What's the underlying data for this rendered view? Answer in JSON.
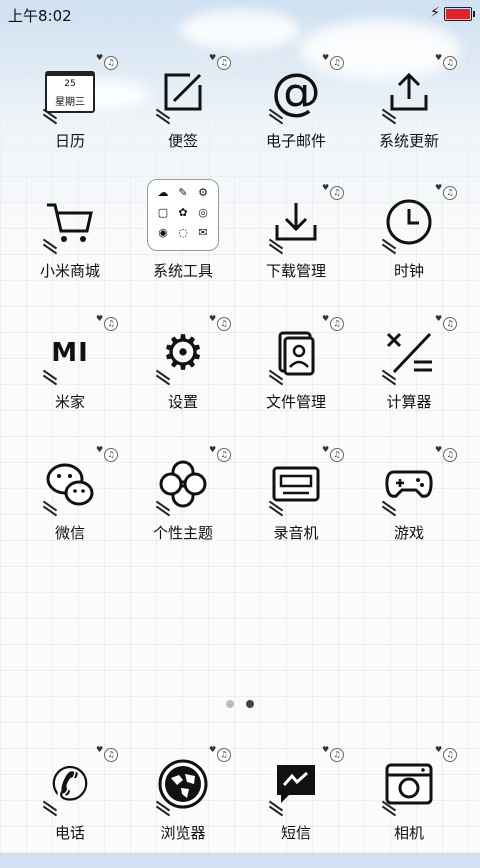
{
  "status_bar": {
    "time": "上午8:02",
    "battery_level": 1.0,
    "battery_color": "#e5222a",
    "charging_icon": "lightning-bolt-icon"
  },
  "calendar": {
    "day": "25",
    "weekday": "星期三"
  },
  "apps": [
    {
      "label": "日历",
      "icon": "calendar-icon"
    },
    {
      "label": "便签",
      "icon": "notes-pencil-icon"
    },
    {
      "label": "电子邮件",
      "icon": "at-sign-icon"
    },
    {
      "label": "系统更新",
      "icon": "upload-arrow-icon"
    },
    {
      "label": "小米商城",
      "icon": "shopping-cart-icon"
    },
    {
      "label": "系统工具",
      "icon": "tools-folder-icon"
    },
    {
      "label": "下载管理",
      "icon": "download-arrow-icon"
    },
    {
      "label": "时钟",
      "icon": "clock-icon"
    },
    {
      "label": "米家",
      "icon": "mi-logo-icon"
    },
    {
      "label": "设置",
      "icon": "gear-icon"
    },
    {
      "label": "文件管理",
      "icon": "file-manager-icon"
    },
    {
      "label": "计算器",
      "icon": "calculator-icon"
    },
    {
      "label": "微信",
      "icon": "wechat-bubbles-icon"
    },
    {
      "label": "个性主题",
      "icon": "clover-theme-icon"
    },
    {
      "label": "录音机",
      "icon": "cassette-recorder-icon"
    },
    {
      "label": "游戏",
      "icon": "gamepad-icon"
    }
  ],
  "page_indicator": {
    "count": 2,
    "active": 2,
    "active_color": "#444444",
    "inactive_color": "#bbbbbb"
  },
  "dock": [
    {
      "label": "电话",
      "icon": "phone-handset-icon"
    },
    {
      "label": "浏览器",
      "icon": "globe-browser-icon"
    },
    {
      "label": "短信",
      "icon": "message-bubble-icon"
    },
    {
      "label": "相机",
      "icon": "camera-icon"
    }
  ]
}
